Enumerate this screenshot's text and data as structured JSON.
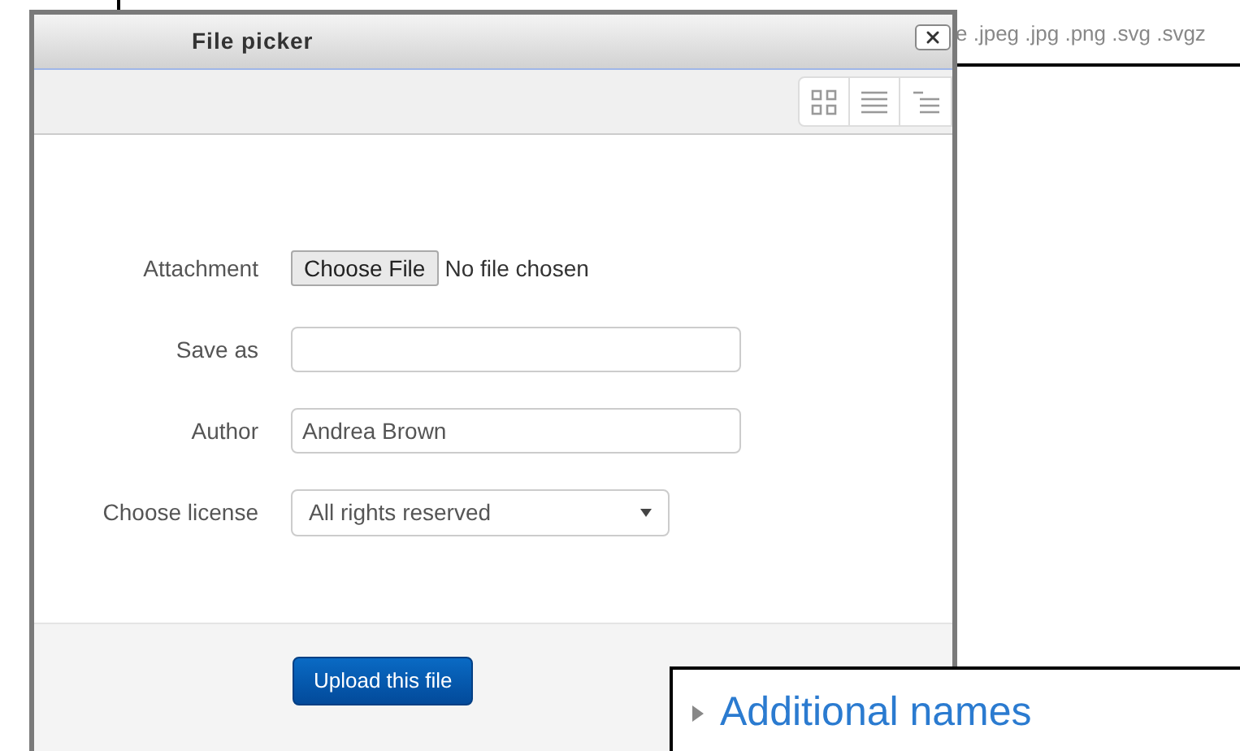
{
  "background": {
    "file_types": "e .jpeg .jpg .png .svg .svgz",
    "section": {
      "title": "Additional names",
      "expanded": false
    }
  },
  "dialog": {
    "title": "File picker",
    "fields": [
      {
        "kind": "file",
        "label": "Attachment",
        "button": "Choose File",
        "status": "No file chosen"
      },
      {
        "kind": "text",
        "label": "Save as"
      },
      {
        "kind": "text",
        "label": "Author",
        "value": "Andrea Brown"
      },
      {
        "kind": "select",
        "label": "Choose license",
        "value": "All rights reserved"
      }
    ],
    "submit": "Upload this file"
  }
}
